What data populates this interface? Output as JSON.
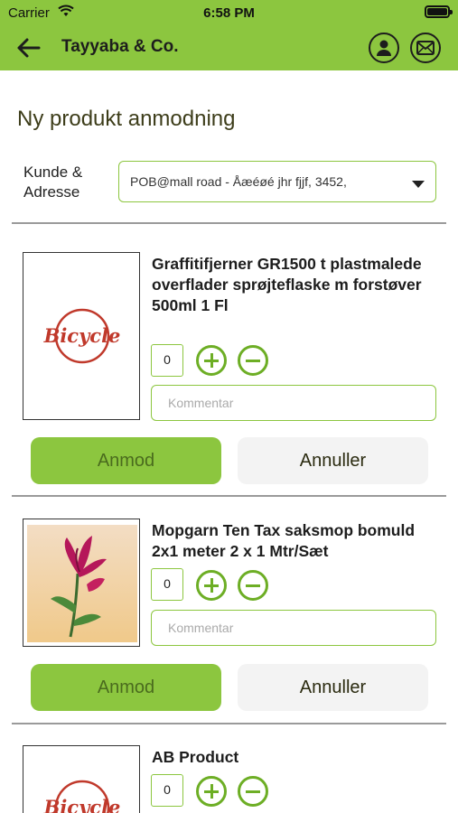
{
  "status_bar": {
    "carrier": "Carrier",
    "time": "6:58 PM"
  },
  "header": {
    "title": "Tayyaba & Co.",
    "icons": [
      "back-arrow-icon",
      "user-icon",
      "mail-icon"
    ]
  },
  "page": {
    "title": "Ny produkt anmodning",
    "kunde_label": "Kunde &\nAdresse",
    "selected_address": "POB@mall road - Åæéøé  jhr fjjf, 3452,"
  },
  "products": [
    {
      "name": "Graffitifjerner GR1500 t plastmalede overflader sprøjteflaske m forstøver 500ml 1 Fl",
      "image": "bicycle-logo",
      "image_text": "Bicycle",
      "qty": "0",
      "comment_placeholder": "Kommentar",
      "request_label": "Anmod",
      "cancel_label": "Annuller"
    },
    {
      "name": "Mopgarn Ten Tax saksmop bomuld 2x1 meter 2 x 1 Mtr/Sæt",
      "image": "flower-painting",
      "qty": "0",
      "comment_placeholder": "Kommentar",
      "request_label": "Anmod",
      "cancel_label": "Annuller"
    },
    {
      "name": "AB Product",
      "image": "bicycle-logo",
      "image_text": "Bicycle",
      "qty": "0"
    }
  ],
  "colors": {
    "accent": "#8cc63f",
    "accent_dark": "#6dae25",
    "logo_red": "#c0392b"
  }
}
